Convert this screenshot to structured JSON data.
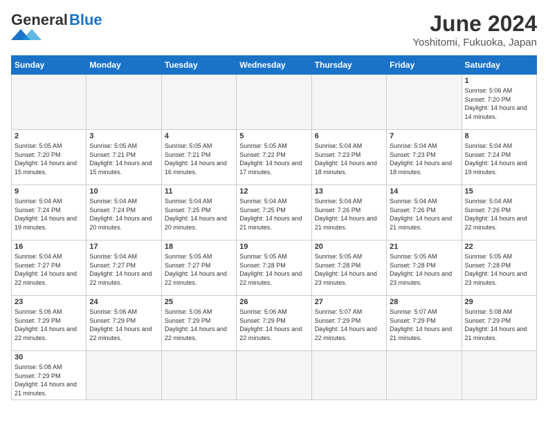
{
  "logo": {
    "general": "General",
    "blue": "Blue"
  },
  "title": "June 2024",
  "subtitle": "Yoshitomi, Fukuoka, Japan",
  "days_of_week": [
    "Sunday",
    "Monday",
    "Tuesday",
    "Wednesday",
    "Thursday",
    "Friday",
    "Saturday"
  ],
  "weeks": [
    [
      {
        "day": "",
        "info": ""
      },
      {
        "day": "",
        "info": ""
      },
      {
        "day": "",
        "info": ""
      },
      {
        "day": "",
        "info": ""
      },
      {
        "day": "",
        "info": ""
      },
      {
        "day": "",
        "info": ""
      },
      {
        "day": "1",
        "info": "Sunrise: 5:06 AM\nSunset: 7:20 PM\nDaylight: 14 hours and 14 minutes."
      }
    ],
    [
      {
        "day": "2",
        "info": "Sunrise: 5:05 AM\nSunset: 7:20 PM\nDaylight: 14 hours and 15 minutes."
      },
      {
        "day": "3",
        "info": "Sunrise: 5:05 AM\nSunset: 7:21 PM\nDaylight: 14 hours and 15 minutes."
      },
      {
        "day": "4",
        "info": "Sunrise: 5:05 AM\nSunset: 7:21 PM\nDaylight: 14 hours and 16 minutes."
      },
      {
        "day": "5",
        "info": "Sunrise: 5:05 AM\nSunset: 7:22 PM\nDaylight: 14 hours and 17 minutes."
      },
      {
        "day": "6",
        "info": "Sunrise: 5:04 AM\nSunset: 7:23 PM\nDaylight: 14 hours and 18 minutes."
      },
      {
        "day": "7",
        "info": "Sunrise: 5:04 AM\nSunset: 7:23 PM\nDaylight: 14 hours and 18 minutes."
      },
      {
        "day": "8",
        "info": "Sunrise: 5:04 AM\nSunset: 7:24 PM\nDaylight: 14 hours and 19 minutes."
      }
    ],
    [
      {
        "day": "9",
        "info": "Sunrise: 5:04 AM\nSunset: 7:24 PM\nDaylight: 14 hours and 19 minutes."
      },
      {
        "day": "10",
        "info": "Sunrise: 5:04 AM\nSunset: 7:24 PM\nDaylight: 14 hours and 20 minutes."
      },
      {
        "day": "11",
        "info": "Sunrise: 5:04 AM\nSunset: 7:25 PM\nDaylight: 14 hours and 20 minutes."
      },
      {
        "day": "12",
        "info": "Sunrise: 5:04 AM\nSunset: 7:25 PM\nDaylight: 14 hours and 21 minutes."
      },
      {
        "day": "13",
        "info": "Sunrise: 5:04 AM\nSunset: 7:26 PM\nDaylight: 14 hours and 21 minutes."
      },
      {
        "day": "14",
        "info": "Sunrise: 5:04 AM\nSunset: 7:26 PM\nDaylight: 14 hours and 21 minutes."
      },
      {
        "day": "15",
        "info": "Sunrise: 5:04 AM\nSunset: 7:26 PM\nDaylight: 14 hours and 22 minutes."
      }
    ],
    [
      {
        "day": "16",
        "info": "Sunrise: 5:04 AM\nSunset: 7:27 PM\nDaylight: 14 hours and 22 minutes."
      },
      {
        "day": "17",
        "info": "Sunrise: 5:04 AM\nSunset: 7:27 PM\nDaylight: 14 hours and 22 minutes."
      },
      {
        "day": "18",
        "info": "Sunrise: 5:05 AM\nSunset: 7:27 PM\nDaylight: 14 hours and 22 minutes."
      },
      {
        "day": "19",
        "info": "Sunrise: 5:05 AM\nSunset: 7:28 PM\nDaylight: 14 hours and 22 minutes."
      },
      {
        "day": "20",
        "info": "Sunrise: 5:05 AM\nSunset: 7:28 PM\nDaylight: 14 hours and 23 minutes."
      },
      {
        "day": "21",
        "info": "Sunrise: 5:05 AM\nSunset: 7:28 PM\nDaylight: 14 hours and 23 minutes."
      },
      {
        "day": "22",
        "info": "Sunrise: 5:05 AM\nSunset: 7:28 PM\nDaylight: 14 hours and 23 minutes."
      }
    ],
    [
      {
        "day": "23",
        "info": "Sunrise: 5:06 AM\nSunset: 7:29 PM\nDaylight: 14 hours and 22 minutes."
      },
      {
        "day": "24",
        "info": "Sunrise: 5:06 AM\nSunset: 7:29 PM\nDaylight: 14 hours and 22 minutes."
      },
      {
        "day": "25",
        "info": "Sunrise: 5:06 AM\nSunset: 7:29 PM\nDaylight: 14 hours and 22 minutes."
      },
      {
        "day": "26",
        "info": "Sunrise: 5:06 AM\nSunset: 7:29 PM\nDaylight: 14 hours and 22 minutes."
      },
      {
        "day": "27",
        "info": "Sunrise: 5:07 AM\nSunset: 7:29 PM\nDaylight: 14 hours and 22 minutes."
      },
      {
        "day": "28",
        "info": "Sunrise: 5:07 AM\nSunset: 7:29 PM\nDaylight: 14 hours and 21 minutes."
      },
      {
        "day": "29",
        "info": "Sunrise: 5:08 AM\nSunset: 7:29 PM\nDaylight: 14 hours and 21 minutes."
      }
    ],
    [
      {
        "day": "30",
        "info": "Sunrise: 5:08 AM\nSunset: 7:29 PM\nDaylight: 14 hours and 21 minutes."
      },
      {
        "day": "",
        "info": ""
      },
      {
        "day": "",
        "info": ""
      },
      {
        "day": "",
        "info": ""
      },
      {
        "day": "",
        "info": ""
      },
      {
        "day": "",
        "info": ""
      },
      {
        "day": "",
        "info": ""
      }
    ]
  ]
}
